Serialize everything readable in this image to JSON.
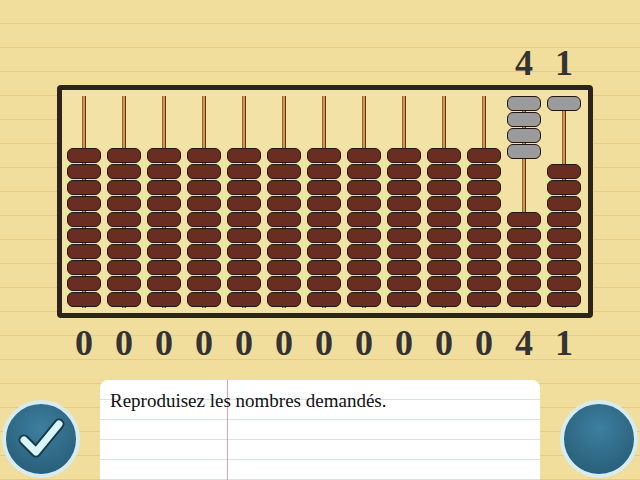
{
  "abacus": {
    "beads_per_rod": 10,
    "columns": [
      {
        "top_label": "",
        "digit": "0",
        "beads_up": 0
      },
      {
        "top_label": "",
        "digit": "0",
        "beads_up": 0
      },
      {
        "top_label": "",
        "digit": "0",
        "beads_up": 0
      },
      {
        "top_label": "",
        "digit": "0",
        "beads_up": 0
      },
      {
        "top_label": "",
        "digit": "0",
        "beads_up": 0
      },
      {
        "top_label": "",
        "digit": "0",
        "beads_up": 0
      },
      {
        "top_label": "",
        "digit": "0",
        "beads_up": 0
      },
      {
        "top_label": "",
        "digit": "0",
        "beads_up": 0
      },
      {
        "top_label": "",
        "digit": "0",
        "beads_up": 0
      },
      {
        "top_label": "",
        "digit": "0",
        "beads_up": 0
      },
      {
        "top_label": "",
        "digit": "0",
        "beads_up": 0
      },
      {
        "top_label": "4",
        "digit": "4",
        "beads_up": 4
      },
      {
        "top_label": "1",
        "digit": "1",
        "beads_up": 1
      }
    ]
  },
  "instruction": "Reproduisez les nombres demandés."
}
